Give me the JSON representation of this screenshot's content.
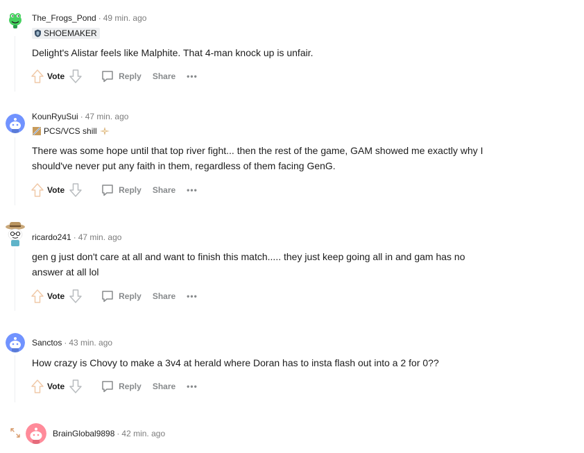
{
  "comments": [
    {
      "author": "The_Frogs_Pond",
      "time": "49 min. ago",
      "flair": "SHOEMAKER",
      "lines": [
        "Delight's Alistar feels like Malphite. That 4-man knock up is unfair."
      ],
      "avatar_color": "#46d160",
      "avatar": "frog-snoo-avatar"
    },
    {
      "author": "KounRyuSui",
      "time": "47 min. ago",
      "flair": "PCS/VCS shill",
      "lines": [
        "There was some hope until that top river fight... then the rest of the game, GAM showed me exactly why I",
        "should've never put any faith in them, regardless of them facing GenG."
      ],
      "avatar_color": "#7193ff",
      "avatar": "snoo-avatar"
    },
    {
      "author": "ricardo241",
      "time": "47 min. ago",
      "flair": "",
      "lines": [
        "gen g just don't care at all and want to finish this match..... they just keep going all in and gam has no",
        "answer at all lol"
      ],
      "avatar_color": "#f4e3c1",
      "avatar": "hat-snoo-avatar"
    },
    {
      "author": "Sanctos",
      "time": "43 min. ago",
      "flair": "",
      "lines": [
        "How crazy is Chovy to make a 3v4 at herald where Doran has to insta flash out into a 2 for 0??"
      ],
      "avatar_color": "#7193ff",
      "avatar": "snoo-avatar"
    },
    {
      "author": "BrainGlobal9898",
      "time": "42 min. ago",
      "avatar_color": "#ff8b9a",
      "avatar": "snoo-avatar"
    }
  ],
  "actions": {
    "vote": "Vote",
    "reply": "Reply",
    "share": "Share",
    "more": "•••"
  },
  "icons": {
    "upvote": "arrow-up-icon",
    "downvote": "arrow-down-icon",
    "reply": "speech-bubble-icon",
    "expand": "expand-arrows-icon"
  }
}
